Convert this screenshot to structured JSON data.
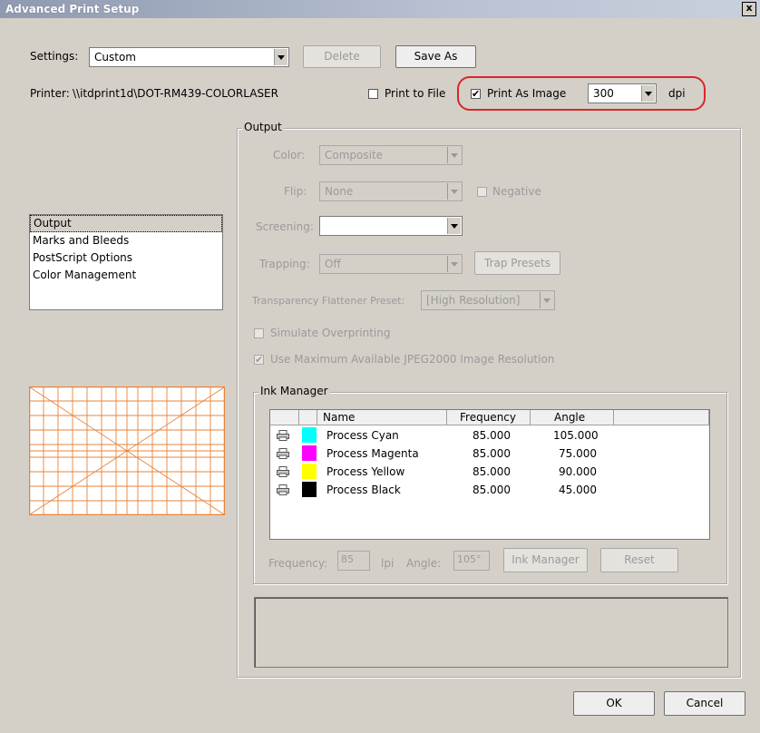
{
  "window": {
    "title": "Advanced Print Setup",
    "close": "x"
  },
  "settings": {
    "label": "Settings:",
    "value": "Custom",
    "delete": "Delete",
    "save_as": "Save As"
  },
  "printer": {
    "label": "Printer:",
    "name": "\\\\itdprint1d\\DOT-RM439-COLORLASER",
    "print_to_file": "Print to File",
    "print_as_image": "Print As Image",
    "print_as_image_checked": true,
    "dpi_value": "300",
    "dpi_unit": "dpi"
  },
  "nav": {
    "items": [
      "Output",
      "Marks and Bleeds",
      "PostScript Options",
      "Color Management"
    ],
    "selected": 0
  },
  "output": {
    "title": "Output",
    "color_label": "Color:",
    "color_value": "Composite",
    "flip_label": "Flip:",
    "flip_value": "None",
    "negative": "Negative",
    "screening_label": "Screening:",
    "screening_value": "",
    "trapping_label": "Trapping:",
    "trapping_value": "Off",
    "trap_presets": "Trap Presets",
    "flattener_label": "Transparency Flattener Preset:",
    "flattener_value": "[High Resolution]",
    "simulate_overprinting": "Simulate Overprinting",
    "use_max_jpeg2000": "Use Maximum Available JPEG2000 Image Resolution"
  },
  "ink_manager": {
    "title": "Ink Manager",
    "columns": [
      "Name",
      "Frequency",
      "Angle"
    ],
    "rows": [
      {
        "name": "Process Cyan",
        "frequency": "85.000",
        "angle": "105.000",
        "color": "#00ffff"
      },
      {
        "name": "Process Magenta",
        "frequency": "85.000",
        "angle": "75.000",
        "color": "#ff00ff"
      },
      {
        "name": "Process Yellow",
        "frequency": "85.000",
        "angle": "90.000",
        "color": "#ffff00"
      },
      {
        "name": "Process Black",
        "frequency": "85.000",
        "angle": "45.000",
        "color": "#000000"
      }
    ],
    "frequency_label": "Frequency:",
    "frequency_value": "85",
    "lpi": "lpi",
    "angle_label": "Angle:",
    "angle_value": "105°",
    "ink_manager_button": "Ink Manager",
    "reset": "Reset"
  },
  "footer": {
    "ok": "OK",
    "cancel": "Cancel"
  },
  "colors": {
    "highlight": "#d72828",
    "preview_grid": "#e8833a"
  }
}
